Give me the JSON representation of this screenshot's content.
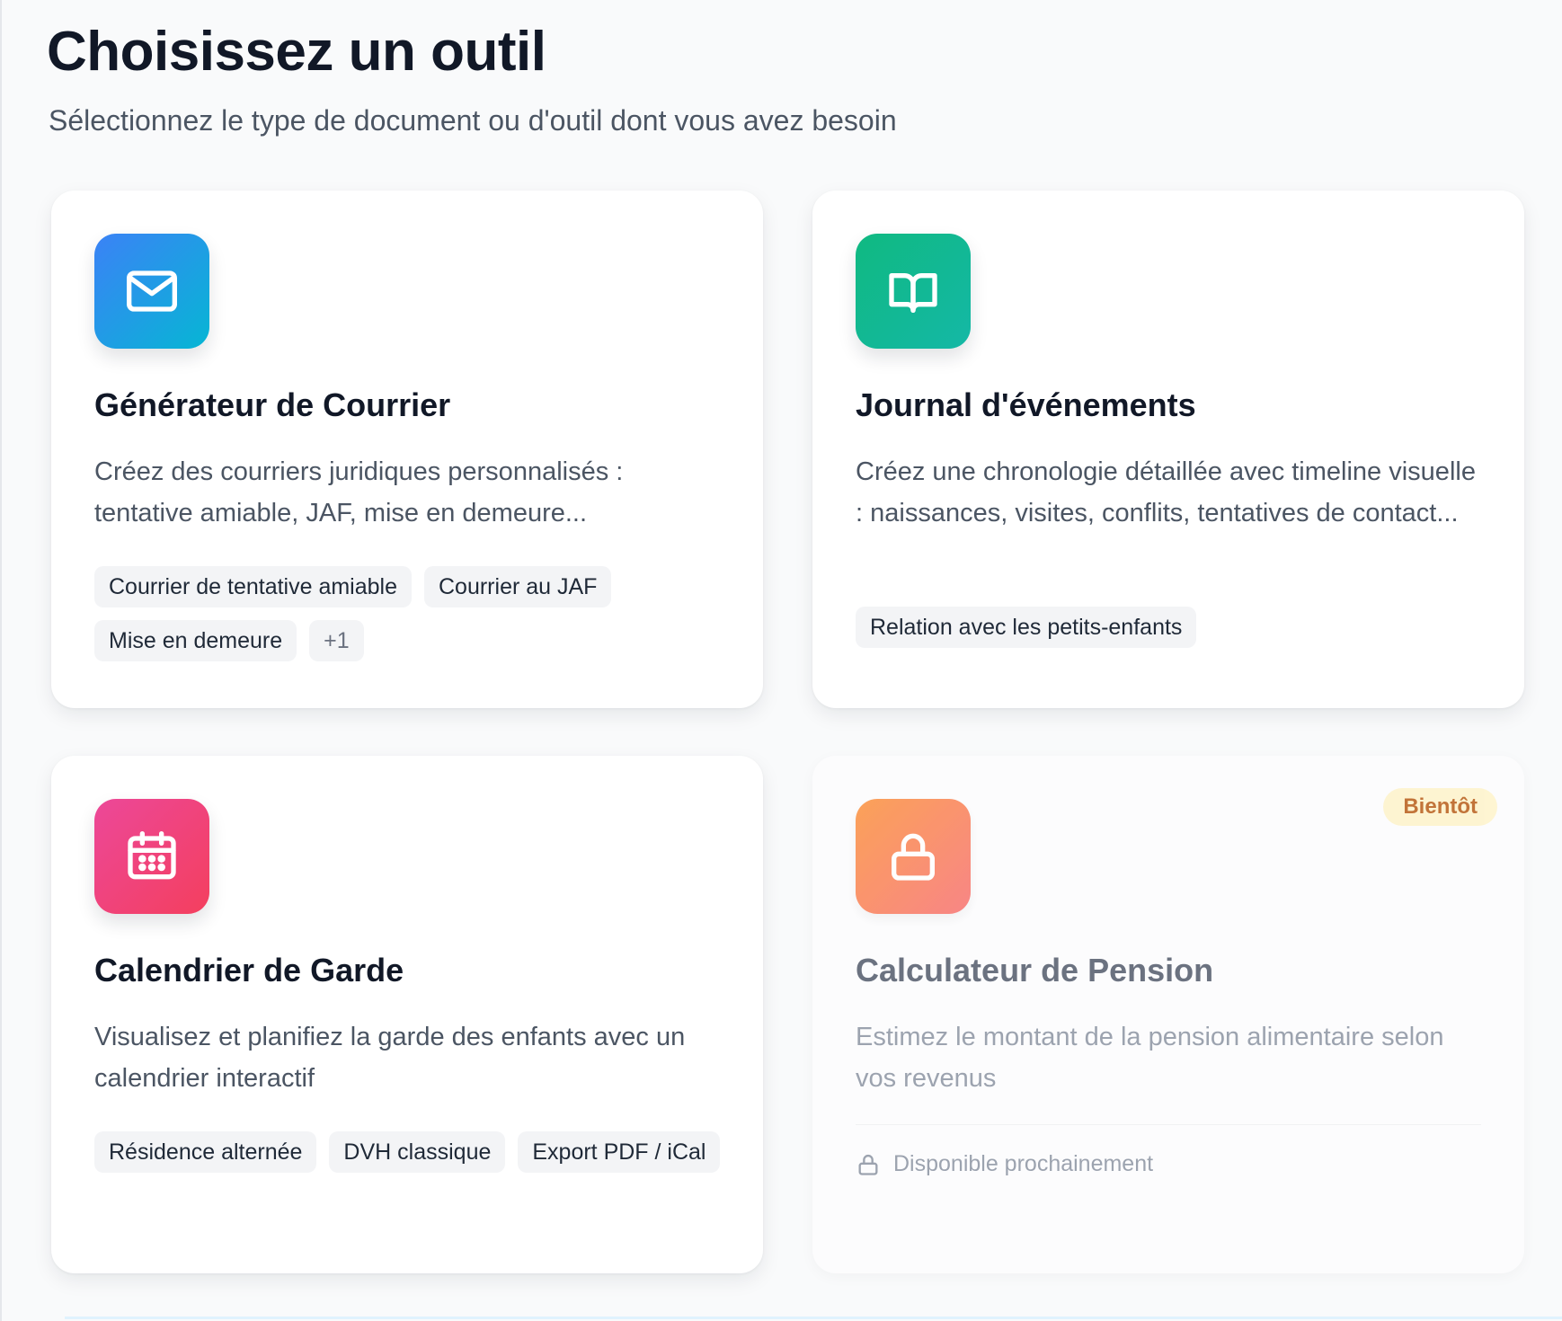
{
  "header": {
    "title": "Choisissez un outil",
    "subtitle": "Sélectionnez le type de document ou d'outil dont vous avez besoin"
  },
  "cards": [
    {
      "icon": "mail-icon",
      "title": "Générateur de Courrier",
      "description": "Créez des courriers juridiques personnalisés : tentative amiable, JAF, mise en demeure...",
      "tags": [
        "Courrier de tentative amiable",
        "Courrier au JAF",
        "Mise en demeure",
        "+1"
      ]
    },
    {
      "icon": "book-open-icon",
      "title": "Journal d'événements",
      "description": "Créez une chronologie détaillée avec timeline visuelle : naissances, visites, conflits, tentatives de contact...",
      "tags": [
        "Relation avec les petits-enfants"
      ]
    },
    {
      "icon": "calendar-icon",
      "title": "Calendrier de Garde",
      "description": "Visualisez et planifiez la garde des enfants avec un calendrier interactif",
      "tags": [
        "Résidence alternée",
        "DVH classique",
        "Export PDF / iCal"
      ]
    },
    {
      "icon": "lock-icon",
      "title": "Calculateur de Pension",
      "description": "Estimez le montant de la pension alimentaire selon vos revenus",
      "badge": "Bientôt",
      "availability": "Disponible prochainement"
    }
  ],
  "colors": {
    "blue_gradient": [
      "#3b82f6",
      "#06b6d4"
    ],
    "green_gradient": [
      "#10b981",
      "#14b8a6"
    ],
    "pink_gradient": [
      "#ec4899",
      "#f43f5e"
    ],
    "orange_gradient": [
      "#fb923c",
      "#f87171"
    ],
    "badge": "#fef3c7"
  }
}
